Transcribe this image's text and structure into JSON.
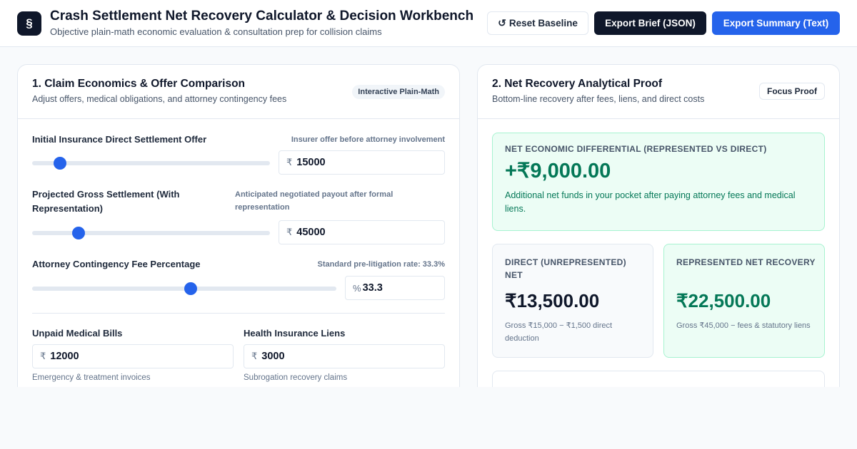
{
  "header": {
    "logo_glyph": "§",
    "title": "Crash Settlement Net Recovery Calculator & Decision Workbench",
    "subtitle": "Objective plain-math economic evaluation & consultation prep for collision claims",
    "reset_icon": "↺",
    "reset_label": "Reset Baseline",
    "export_json_label": "Export Brief (JSON)",
    "export_text_label": "Export Summary (Text)"
  },
  "left_panel": {
    "title": "1. Claim Economics & Offer Comparison",
    "subtitle": "Adjust offers, medical obligations, and attorney contingency fees",
    "pill": "Interactive Plain-Math",
    "initial_offer": {
      "label": "Initial Insurance Direct Settlement Offer",
      "hint": "Insurer offer before attorney involvement",
      "prefix": "₹",
      "value": "15000",
      "slider_fraction": 0.117
    },
    "gross_settlement": {
      "label": "Projected Gross Settlement (With Representation)",
      "hint": "Anticipated negotiated payout after formal representation",
      "prefix": "₹",
      "value": "45000",
      "slider_fraction": 0.195
    },
    "contingency_fee": {
      "label": "Attorney Contingency Fee Percentage",
      "hint": "Standard pre-litigation rate: 33.3%",
      "prefix": "%",
      "value": "33.3",
      "slider_fraction": 0.52
    },
    "medical_bills": {
      "label": "Unpaid Medical Bills",
      "prefix": "₹",
      "value": "12000",
      "note": "Emergency & treatment invoices"
    },
    "health_liens": {
      "label": "Health Insurance Liens",
      "prefix": "₹",
      "value": "3000",
      "note": "Subrogation recovery claims"
    }
  },
  "right_panel": {
    "title": "2. Net Recovery Analytical Proof",
    "subtitle": "Bottom-line recovery after fees, liens, and direct costs",
    "focus_label": "Focus Proof",
    "differential": {
      "label": "NET ECONOMIC DIFFERENTIAL (REPRESENTED VS DIRECT)",
      "value": "+₹9,000.00",
      "description": "Additional net funds in your pocket after paying attorney fees and medical liens."
    },
    "direct": {
      "label": "DIRECT (UNREPRESENTED) NET",
      "value": "₹13,500.00",
      "note": "Gross ₹15,000 − ₹1,500 direct deduction"
    },
    "represented": {
      "label": "REPRESENTED NET RECOVERY",
      "value": "₹22,500.00",
      "note": "Gross ₹45,000 − fees & statutory liens"
    }
  },
  "colors": {
    "accent": "#2563eb",
    "dark": "#0f172a",
    "positive": "#047857",
    "positive_bg": "#ecfdf5"
  }
}
